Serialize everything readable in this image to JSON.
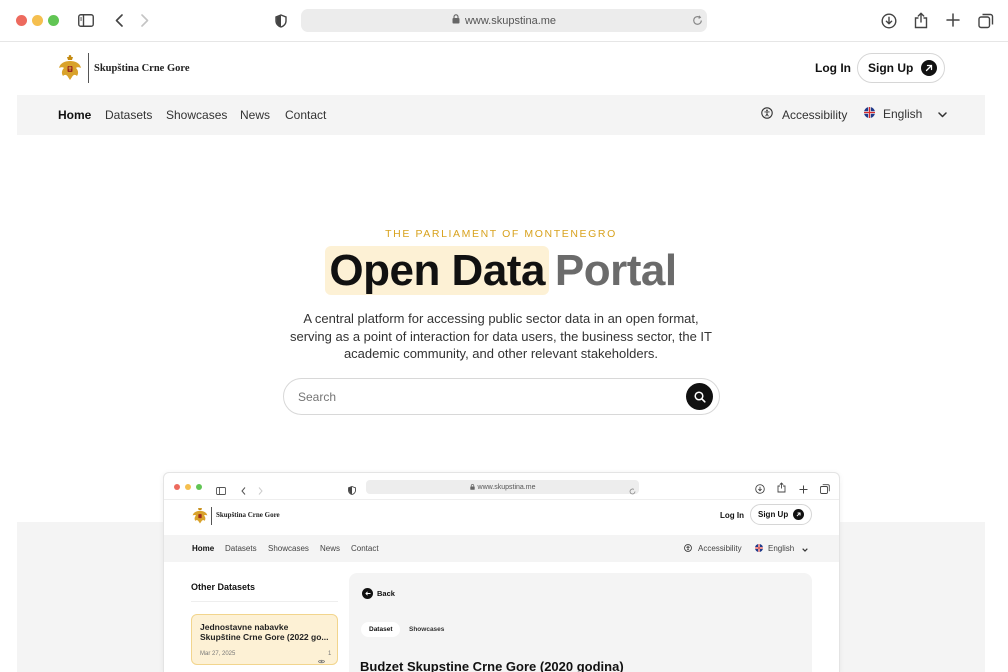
{
  "browser": {
    "url": "www.skupstina.me",
    "traffic_colors": [
      "#ed6a5e",
      "#f5bf4f",
      "#61c554"
    ]
  },
  "header": {
    "logo_text": "Skupština Crne Gore",
    "login_label": "Log In",
    "signup_label": "Sign Up"
  },
  "nav": {
    "items": [
      "Home",
      "Datasets",
      "Showcases",
      "News",
      "Contact"
    ],
    "accessibility_label": "Accessibility",
    "language_label": "English"
  },
  "hero": {
    "eyebrow": "THE PARLIAMENT OF MONTENEGRO",
    "title_highlight": "Open Data",
    "title_rest": "Portal",
    "description_line1": "A central platform for accessing public sector data in an open format,",
    "description_line2": "serving as a point of interaction for data users, the business sector, the IT",
    "description_line3": "academic community, and other relevant stakeholders.",
    "search_placeholder": "Search",
    "accent_color": "#d8a21e",
    "highlight_color": "#fdf1d5"
  },
  "preview": {
    "url": "www.skupstina.me",
    "logo_text": "Skupština Crne Gore",
    "login_label": "Log In",
    "signup_label": "Sign Up",
    "nav_items": [
      "Home",
      "Datasets",
      "Showcases",
      "News",
      "Contact"
    ],
    "accessibility_label": "Accessibility",
    "language_label": "English",
    "sidebar_title": "Other Datasets",
    "card_title_line1": "Jednostavne nabavke",
    "card_title_line2": "Skupštine Crne Gore (2022 go...",
    "card_date": "Mar 27, 2025",
    "card_count": "1",
    "back_label": "Back",
    "tab_dataset": "Dataset",
    "tab_showcases": "Showcases",
    "dataset_title": "Budzet Skupstine Crne Gore (2020 godina)"
  }
}
